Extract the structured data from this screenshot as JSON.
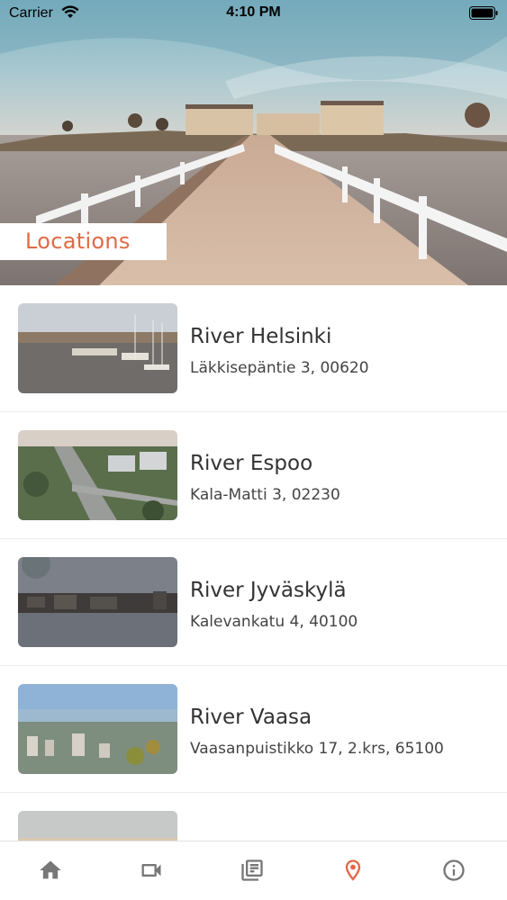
{
  "status_bar": {
    "carrier": "Carrier",
    "time": "4:10 PM"
  },
  "hero": {
    "title": "Locations"
  },
  "locations": [
    {
      "name": "River Helsinki",
      "address": "Läkkisepäntie 3, 00620"
    },
    {
      "name": "River Espoo",
      "address": "Kala-Matti 3, 02230"
    },
    {
      "name": "River Jyväskylä",
      "address": "Kalevankatu 4, 40100"
    },
    {
      "name": "River Vaasa",
      "address": "Vaasanpuistikko 17, 2.krs, 65100"
    }
  ],
  "tab_bar": {
    "tabs": [
      {
        "icon": "home-icon",
        "active": false
      },
      {
        "icon": "video-camera-icon",
        "active": false
      },
      {
        "icon": "news-icon",
        "active": false
      },
      {
        "icon": "location-pin-icon",
        "active": true
      },
      {
        "icon": "info-icon",
        "active": false
      }
    ]
  },
  "colors": {
    "accent": "#e06a45",
    "inactive_icon": "#777777"
  }
}
